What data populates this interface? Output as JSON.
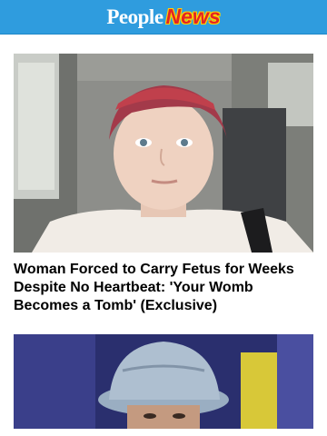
{
  "header": {
    "logo_people": "People",
    "logo_news": "News",
    "background": "#2f9cde"
  },
  "articles": [
    {
      "headline": "Woman Forced to Carry Fetus for Weeks Despite No Heartbeat: 'Your Womb Becomes a Tomb' (Exclusive)",
      "image": "woman-in-car-photo"
    },
    {
      "headline": "",
      "image": "man-in-bucket-hat-photo"
    }
  ]
}
